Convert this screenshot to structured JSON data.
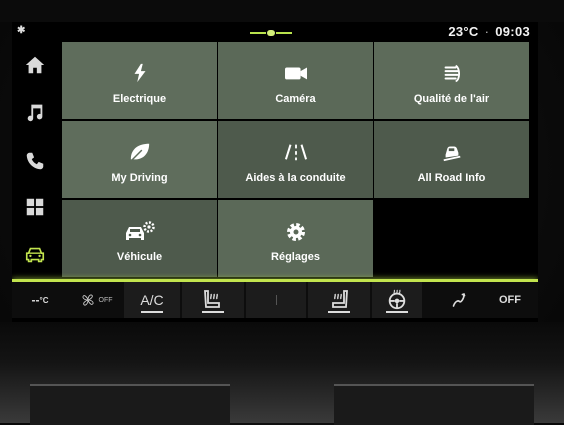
{
  "status": {
    "temperature": "23°C",
    "separator": "·",
    "time": "09:03"
  },
  "menu": {
    "tiles": [
      {
        "label": "Electrique",
        "icon": "lightning-icon"
      },
      {
        "label": "Caméra",
        "icon": "camera-icon"
      },
      {
        "label": "Qualité de l'air",
        "icon": "air-quality-icon"
      },
      {
        "label": "My Driving",
        "icon": "leaf-icon"
      },
      {
        "label": "Aides à la conduite",
        "icon": "road-lanes-icon"
      },
      {
        "label": "All Road Info",
        "icon": "car-incline-icon"
      },
      {
        "label": "Véhicule",
        "icon": "car-settings-icon"
      },
      {
        "label": "Réglages",
        "icon": "gear-icon"
      }
    ]
  },
  "sidebar": {
    "items": [
      {
        "icon": "home-icon"
      },
      {
        "icon": "music-icon"
      },
      {
        "icon": "phone-icon"
      },
      {
        "icon": "apps-grid-icon"
      },
      {
        "icon": "vehicle-icon",
        "active": true
      }
    ]
  },
  "climate": {
    "left_temp": "--",
    "left_temp_unit": "°C",
    "fan_off_label": "OFF",
    "ac_label": "A/C",
    "off_label": "OFF"
  },
  "colors": {
    "accent": "#c2e44e",
    "tile_light": "#5f6d5c",
    "tile_dark": "#4e5a4c"
  }
}
